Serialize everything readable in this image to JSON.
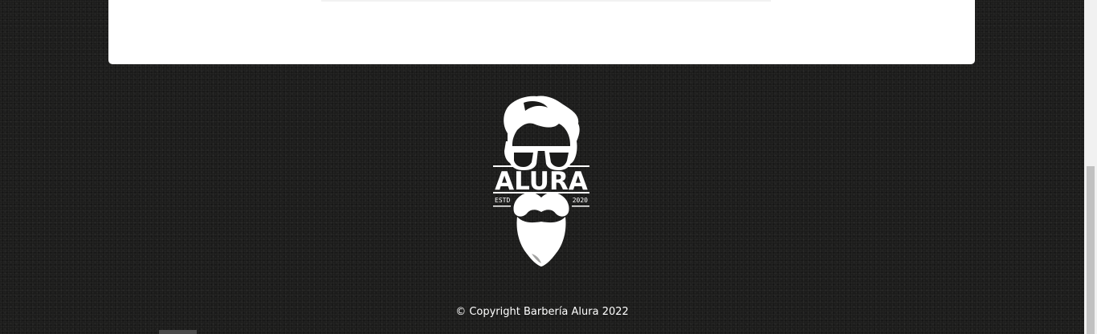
{
  "logo": {
    "brand": "ALURA",
    "est_left": "ESTD",
    "est_right": "2020",
    "icon": "bearded-man-logo"
  },
  "footer": {
    "copyright": "© Copyright Barbería Alura 2022"
  },
  "colors": {
    "background": "#1b1b1a",
    "card": "#ffffff",
    "logo": "#ffffff",
    "text": "#ffffff"
  }
}
